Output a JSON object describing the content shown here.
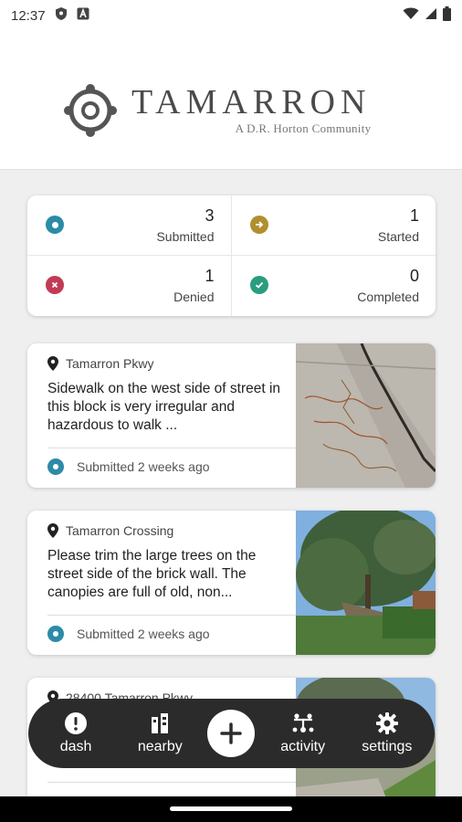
{
  "status_bar": {
    "time": "12:37"
  },
  "header": {
    "brand": "TAMARRON",
    "tagline": "A  D.R. Horton Community"
  },
  "stats": [
    {
      "count": "3",
      "label": "Submitted",
      "icon": "submitted-icon",
      "color": "#2c8ba8"
    },
    {
      "count": "1",
      "label": "Started",
      "icon": "started-arrow-icon",
      "color": "#b18f2e"
    },
    {
      "count": "1",
      "label": "Denied",
      "icon": "denied-x-icon",
      "color": "#c23b55"
    },
    {
      "count": "0",
      "label": "Completed",
      "icon": "completed-check-icon",
      "color": "#2a9d7f"
    }
  ],
  "requests": [
    {
      "location": "Tamarron Pkwy",
      "description": "Sidewalk on the west side of street in this block is very irregular and hazardous to walk ...",
      "status": "Submitted 2 weeks ago"
    },
    {
      "location": "Tamarron Crossing",
      "description": "Please trim the large trees on the street side of the brick wall. The canopies are full of old, non...",
      "status": "Submitted 2 weeks ago"
    },
    {
      "location": "28400 Tamarron Pkwy",
      "description": "",
      "status": ""
    }
  ],
  "nav": {
    "dash": "dash",
    "nearby": "nearby",
    "activity": "activity",
    "settings": "settings"
  }
}
